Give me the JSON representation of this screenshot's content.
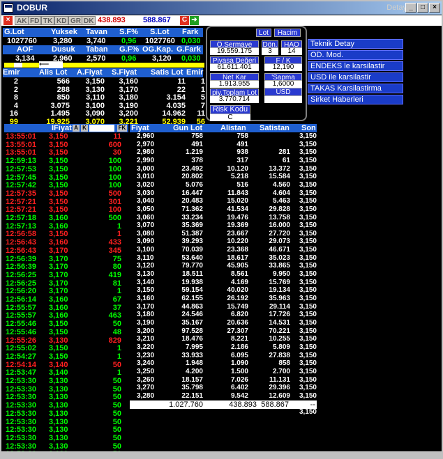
{
  "window": {
    "title": "DOBUR",
    "right_text": "Detay",
    "min": "_",
    "max": "□",
    "close": "×"
  },
  "toolbar": {
    "items": [
      "AK",
      "FD",
      "TK",
      "KD",
      "GR",
      "DK"
    ],
    "value1": "438.893",
    "value2": "588.867",
    "c_label": "C"
  },
  "summary": {
    "headers": [
      "G.Lot",
      "Yuksek",
      "Tavan",
      "S.F%",
      "S.Lot",
      "Fark"
    ],
    "values": [
      "1027760",
      "3,280",
      "3,740",
      "0,96",
      "1027760",
      "0,030"
    ],
    "headers2": [
      "AOF",
      "Dusuk",
      "Taban",
      "G.F%",
      "OG.Kap.",
      "G.Fark"
    ],
    "values2": [
      "3,134",
      "2,960",
      "2,570",
      "0,96",
      "3,120",
      "0,030"
    ]
  },
  "emir": {
    "headers": [
      "Emir",
      "Alis Lot",
      "A.Fiyat",
      "S.Fiyat",
      "Satis Lot",
      "Emir"
    ],
    "rows": [
      [
        "2",
        "566",
        "3,150",
        "3,160",
        "11",
        "1"
      ],
      [
        "2",
        "288",
        "3,130",
        "3,170",
        "22",
        "1"
      ],
      [
        "8",
        "850",
        "3,110",
        "3,180",
        "3.154",
        "5"
      ],
      [
        "4",
        "3.075",
        "3,100",
        "3,190",
        "4.035",
        "7"
      ],
      [
        "16",
        "1.495",
        "3,090",
        "3,200",
        "14.962",
        "11"
      ]
    ],
    "total": [
      "99",
      "19.925",
      "3,070",
      "3,221",
      "52.939",
      "56"
    ]
  },
  "panel": {
    "lot": "Lot",
    "hacim": "Hacim",
    "osermaye_label": "Ö.Sermaye",
    "osermaye": "19.559.175",
    "don_label": "Dön.",
    "don": "3",
    "hao_label": "HAO",
    "hao": "14",
    "piyasa_label": "Piyasa Değeri",
    "piyasa": "61.611.401",
    "fk_label": "F / K",
    "fk": "12,190",
    "netkar_label": "Net Kar",
    "netkar": "1.913.955",
    "sapma_label": "'Sapma",
    "sapma": "1,6000",
    "piytop_label": "piy.Toplam Lot",
    "piytop": "3.770.714",
    "usd_label": "USD Değeri",
    "risk_label": "Risk Kodu",
    "risk": "C"
  },
  "menu": [
    "Teknik Detay",
    "OD. Mod.",
    "ENDEKS le karsilastir",
    "USD ile karsilastir",
    "TAKAS Karsilastirma",
    "Sirket Haberleri"
  ],
  "trades": {
    "header_fiyat": "IFiyat",
    "header_a": "A",
    "header_k": "K",
    "header_fk": "FK",
    "rows": [
      [
        "13:55:01",
        "3,150",
        "11",
        "red"
      ],
      [
        "13:55:01",
        "3,150",
        "600",
        "red"
      ],
      [
        "13:55:01",
        "3,150",
        "30",
        "red"
      ],
      [
        "12:59:13",
        "3,150",
        "100",
        "green"
      ],
      [
        "12:57:53",
        "3,150",
        "100",
        "green"
      ],
      [
        "12:57:45",
        "3,150",
        "100",
        "green"
      ],
      [
        "12:57:42",
        "3,150",
        "100",
        "green"
      ],
      [
        "12:57:35",
        "3,150",
        "500",
        "red"
      ],
      [
        "12:57:21",
        "3,150",
        "301",
        "red"
      ],
      [
        "12:57:21",
        "3,150",
        "100",
        "red"
      ],
      [
        "12:57:18",
        "3,160",
        "500",
        "green"
      ],
      [
        "12:57:13",
        "3,160",
        "1",
        "green"
      ],
      [
        "12:56:58",
        "3,150",
        "1",
        "red"
      ],
      [
        "12:56:43",
        "3,160",
        "433",
        "red"
      ],
      [
        "12:56:43",
        "3,170",
        "345",
        "red"
      ],
      [
        "12:56:39",
        "3,170",
        "75",
        "green"
      ],
      [
        "12:56:39",
        "3,170",
        "80",
        "green"
      ],
      [
        "12:56:25",
        "3,170",
        "419",
        "green"
      ],
      [
        "12:56:25",
        "3,170",
        "81",
        "green"
      ],
      [
        "12:56:20",
        "3,170",
        "1",
        "green"
      ],
      [
        "12:56:14",
        "3,160",
        "67",
        "green"
      ],
      [
        "12:55:57",
        "3,160",
        "37",
        "green"
      ],
      [
        "12:55:57",
        "3,160",
        "463",
        "green"
      ],
      [
        "12:55:46",
        "3,150",
        "50",
        "green"
      ],
      [
        "12:55:46",
        "3,150",
        "48",
        "green"
      ],
      [
        "12:55:26",
        "3,130",
        "829",
        "red"
      ],
      [
        "12:55:02",
        "3,150",
        "1",
        "green"
      ],
      [
        "12:54:27",
        "3,150",
        "1",
        "green"
      ],
      [
        "12:54:14",
        "3,140",
        "50",
        "red"
      ],
      [
        "12:53:47",
        "3,140",
        "1",
        "green"
      ],
      [
        "12:53:30",
        "3,130",
        "50",
        "green"
      ],
      [
        "12:53:30",
        "3,130",
        "50",
        "green"
      ],
      [
        "12:53:30",
        "3,130",
        "50",
        "green"
      ],
      [
        "12:53:30",
        "3,130",
        "50",
        "green"
      ],
      [
        "12:53:30",
        "3,130",
        "50",
        "green"
      ],
      [
        "12:53:30",
        "3,130",
        "50",
        "green"
      ],
      [
        "12:53:30",
        "3,130",
        "50",
        "green"
      ],
      [
        "12:53:30",
        "3,130",
        "50",
        "green"
      ],
      [
        "12:53:30",
        "3,130",
        "50",
        "green"
      ],
      [
        "12:53:30",
        "3,130",
        "50",
        "green"
      ]
    ]
  },
  "depth": {
    "headers": [
      "Fiyat",
      "Gun Lot",
      "Alistan",
      "Satistan",
      "Son"
    ],
    "rows": [
      [
        "2,960",
        "758",
        "758",
        "",
        "3,150"
      ],
      [
        "2,970",
        "491",
        "491",
        "",
        "3,150"
      ],
      [
        "2,980",
        "1.219",
        "938",
        "281",
        "3,150"
      ],
      [
        "2,990",
        "378",
        "317",
        "61",
        "3,150"
      ],
      [
        "3,000",
        "23.492",
        "10.120",
        "13.372",
        "3,150"
      ],
      [
        "3,010",
        "20.802",
        "5.218",
        "15.584",
        "3,150"
      ],
      [
        "3,020",
        "5.076",
        "516",
        "4.560",
        "3,150"
      ],
      [
        "3,030",
        "16.447",
        "11.843",
        "4.604",
        "3,150"
      ],
      [
        "3,040",
        "20.483",
        "15.020",
        "5.463",
        "3,150"
      ],
      [
        "3,050",
        "71.362",
        "41.534",
        "29.828",
        "3,150"
      ],
      [
        "3,060",
        "33.234",
        "19.476",
        "13.758",
        "3,150"
      ],
      [
        "3,070",
        "35.369",
        "19.369",
        "16.000",
        "3,150"
      ],
      [
        "3,080",
        "51.387",
        "23.667",
        "27.720",
        "3,150"
      ],
      [
        "3,090",
        "39.293",
        "10.220",
        "29.073",
        "3,150"
      ],
      [
        "3,100",
        "70.039",
        "23.368",
        "46.671",
        "3,150"
      ],
      [
        "3,110",
        "53.640",
        "18.617",
        "35.023",
        "3,150"
      ],
      [
        "3,120",
        "79.770",
        "45.905",
        "33.865",
        "3,150"
      ],
      [
        "3,130",
        "18.511",
        "8.561",
        "9.950",
        "3,150"
      ],
      [
        "3,140",
        "19.938",
        "4.169",
        "15.769",
        "3,150"
      ],
      [
        "3,150",
        "59.154",
        "40.020",
        "19.134",
        "3,150"
      ],
      [
        "3,160",
        "62.155",
        "26.192",
        "35.963",
        "3,150"
      ],
      [
        "3,170",
        "44.863",
        "15.749",
        "29.114",
        "3,150"
      ],
      [
        "3,180",
        "24.546",
        "6.820",
        "17.726",
        "3,150"
      ],
      [
        "3,190",
        "35.167",
        "20.636",
        "14.531",
        "3,150"
      ],
      [
        "3,200",
        "97.528",
        "27.307",
        "70.221",
        "3,150"
      ],
      [
        "3,210",
        "18.476",
        "8.221",
        "10.255",
        "3,150"
      ],
      [
        "3,220",
        "7.995",
        "2.186",
        "5.809",
        "3,150"
      ],
      [
        "3,230",
        "33.933",
        "6.095",
        "27.838",
        "3,150"
      ],
      [
        "3,240",
        "1.948",
        "1.090",
        "858",
        "3,150"
      ],
      [
        "3,250",
        "4.200",
        "1.500",
        "2.700",
        "3,150"
      ],
      [
        "3,260",
        "18.157",
        "7.026",
        "11.131",
        "3,150"
      ],
      [
        "3,270",
        "35.798",
        "6.402",
        "29.396",
        "3,150"
      ],
      [
        "3,280",
        "22.151",
        "9.542",
        "12.609",
        "3,150"
      ],
      [
        "",
        "",
        "",
        "",
        "3,150"
      ],
      [
        "",
        "",
        "",
        "",
        "3,150"
      ]
    ],
    "totals": [
      "1.027.760",
      "438.893",
      "588.867",
      "--"
    ]
  }
}
